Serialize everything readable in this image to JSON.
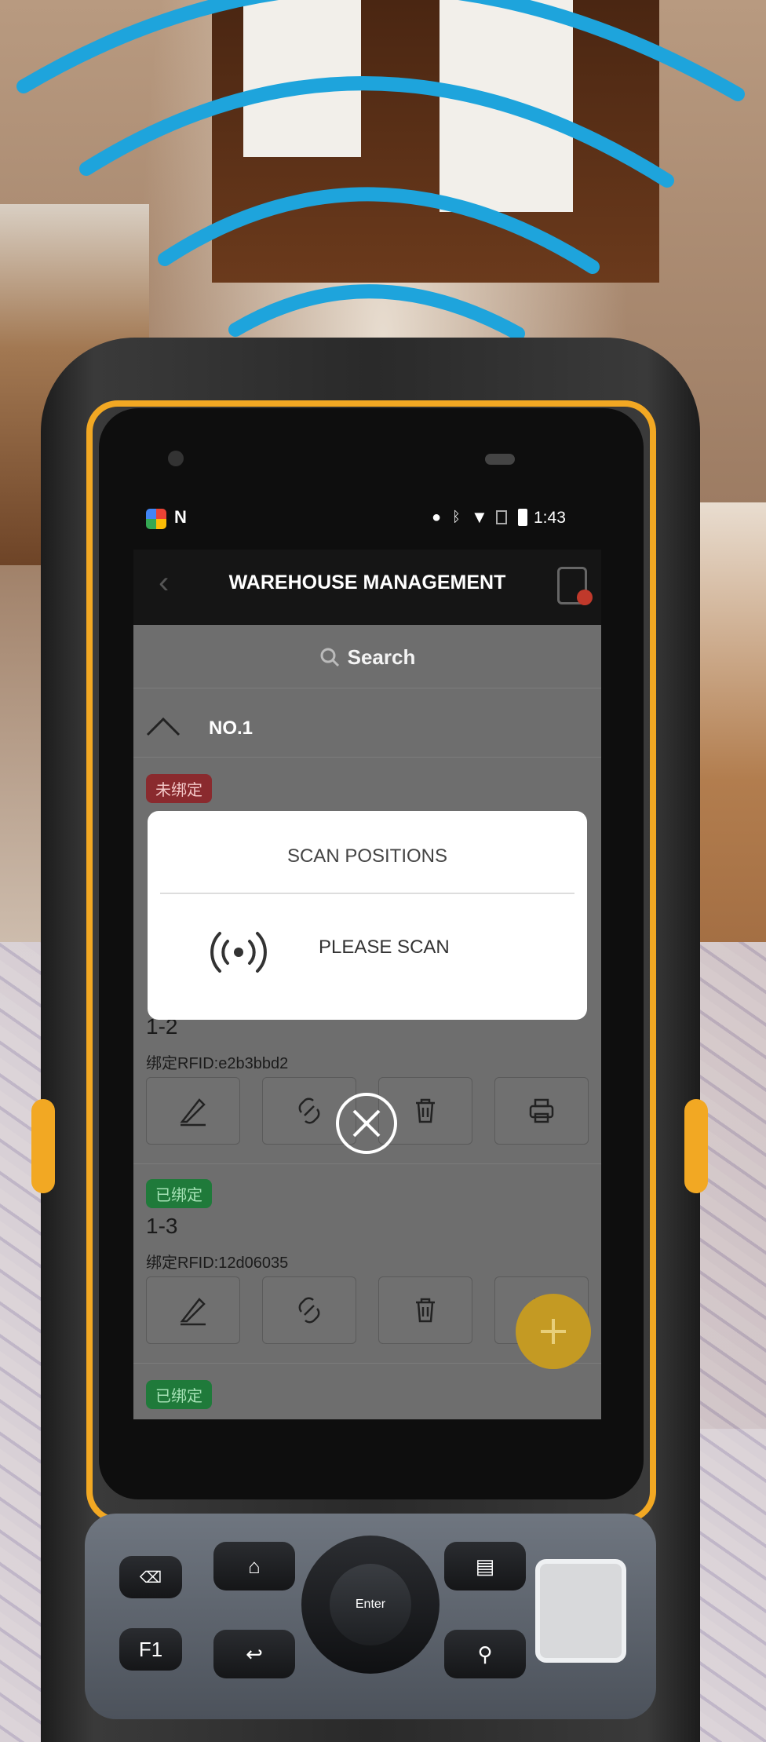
{
  "statusbar": {
    "time": "1:43",
    "icons": [
      "app-icon",
      "n-icon",
      "location-icon",
      "bluetooth-icon",
      "wifi-icon",
      "sim-icon",
      "battery-icon"
    ]
  },
  "appbar": {
    "title": "WAREHOUSE MANAGEMENT",
    "back_icon": "chevron-left-icon",
    "right_icon": "device-alert-icon"
  },
  "search": {
    "label": "Search",
    "icon": "search-icon"
  },
  "group": {
    "label": "NO.1",
    "expand_icon": "chevron-up-icon"
  },
  "items": [
    {
      "status": "未绑定",
      "status_color": "#8a2a2e"
    },
    {
      "code": "1-2",
      "rfid": "绑定RFID:e2b3bbd2"
    },
    {
      "status": "已绑定",
      "code": "1-3",
      "rfid": "绑定RFID:12d06035",
      "status_color": "#1f7a3a"
    },
    {
      "status": "已绑定",
      "status_color": "#1f7a3a"
    }
  ],
  "actions": [
    "edit-icon",
    "link-icon",
    "trash-icon",
    "print-icon"
  ],
  "modal": {
    "title": "SCAN POSITIONS",
    "message": "PLEASE SCAN",
    "icon": "rfid-signal-icon"
  },
  "keypad": {
    "enter": "Enter",
    "f1": "F1",
    "icons": [
      "delete-key-icon",
      "home-icon",
      "back-icon",
      "menu-icon",
      "search-key-icon"
    ]
  },
  "colors": {
    "accent": "#f2a823",
    "signal": "#1ea4dc",
    "fab": "#c49a23"
  }
}
